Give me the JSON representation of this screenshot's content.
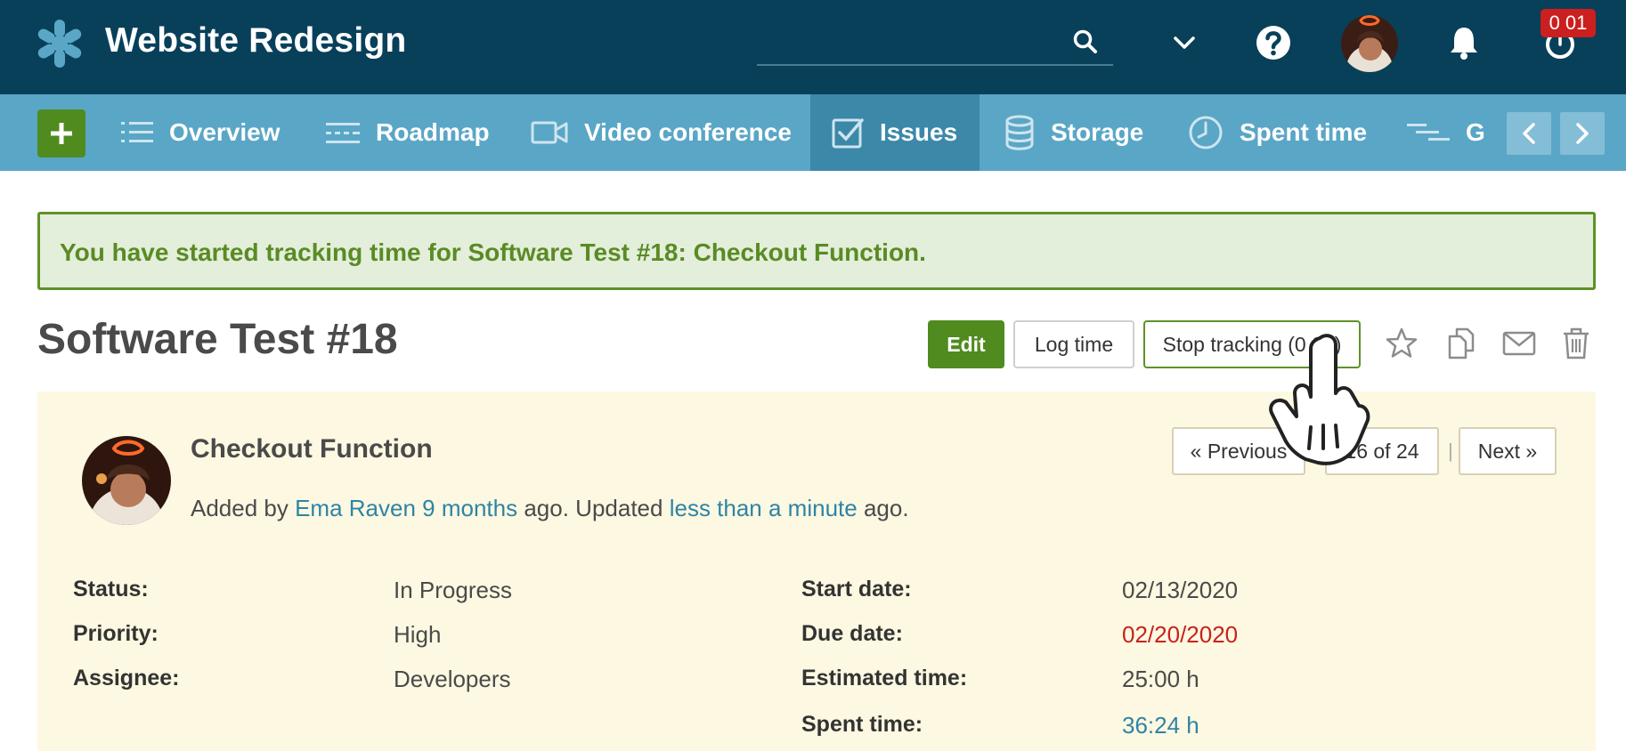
{
  "header": {
    "project_title": "Website Redesign",
    "timer_badge": "0 01",
    "icons": [
      "search-icon",
      "chevron-down-icon",
      "help-icon",
      "avatar",
      "bell-icon",
      "timer-icon"
    ]
  },
  "nav": {
    "items": [
      {
        "label": "Overview",
        "icon": "list-icon"
      },
      {
        "label": "Roadmap",
        "icon": "roadmap-icon"
      },
      {
        "label": "Video conference",
        "icon": "video-icon"
      },
      {
        "label": "Issues",
        "icon": "checkbox-icon",
        "active": true
      },
      {
        "label": "Storage",
        "icon": "database-icon"
      },
      {
        "label": "Spent time",
        "icon": "clock-icon"
      },
      {
        "label": "G",
        "icon": "gantt-icon"
      }
    ]
  },
  "flash": {
    "message": "You have started tracking time for Software Test #18: Checkout Function."
  },
  "issue": {
    "title": "Software Test #18",
    "subject": "Checkout Function",
    "meta_added_by": "Added by ",
    "meta_author": "Ema Raven",
    "meta_space": " ",
    "meta_created_ago": "9 months",
    "meta_mid": " ago. Updated ",
    "meta_updated_ago": "less than a minute",
    "meta_end": " ago."
  },
  "actions": {
    "edit": "Edit",
    "log_time": "Log time",
    "stop_tracking": "Stop tracking (0 01)"
  },
  "pager": {
    "previous": "« Previous",
    "position": "16 of 24",
    "separator": "|",
    "next": "Next »"
  },
  "attributes": {
    "status_label": "Status:",
    "status_value": "In Progress",
    "priority_label": "Priority:",
    "priority_value": "High",
    "assignee_label": "Assignee:",
    "assignee_value": "Developers",
    "start_label": "Start date:",
    "start_value": "02/13/2020",
    "due_label": "Due date:",
    "due_value": "02/20/2020",
    "estimated_label": "Estimated time:",
    "estimated_value": "25:00 h",
    "spent_label": "Spent time:",
    "spent_value": "36:24 h"
  },
  "colors": {
    "header_bg": "#08405a",
    "nav_bg": "#5aa6c6",
    "nav_active_bg": "#3b88a9",
    "accent_green": "#4f8b1f",
    "flash_bg": "#e3eedb",
    "panel_bg": "#fdf8e1",
    "link": "#2e84a6",
    "overdue": "#c7231c"
  }
}
